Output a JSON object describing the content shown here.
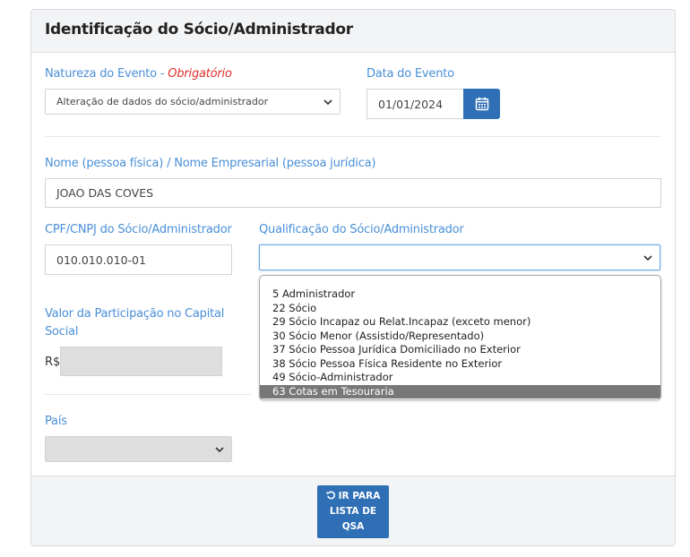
{
  "panel": {
    "title": "Identificação do Sócio/Administrador"
  },
  "natureza": {
    "label": "Natureza do Evento - ",
    "required": "Obrigatório",
    "value": "Alteração de dados do sócio/administrador"
  },
  "data_evento": {
    "label": "Data do Evento",
    "value": "01/01/2024",
    "icon": "calendar-icon"
  },
  "nome": {
    "label": "Nome (pessoa física) / Nome Empresarial (pessoa jurídica)",
    "value": "JOAO DAS COVES"
  },
  "cpf": {
    "label": "CPF/CNPJ do Sócio/Administrador",
    "value": "010.010.010-01"
  },
  "qualificacao": {
    "label": "Qualificação do Sócio/Administrador",
    "value": "",
    "options": [
      "5 Administrador",
      "22 Sócio",
      "29 Sócio Incapaz ou Relat.Incapaz (exceto menor)",
      "30 Sócio Menor (Assistido/Representado)",
      "37 Sócio Pessoa Jurídica Domiciliado no Exterior",
      "38 Sócio Pessoa Física Residente no Exterior",
      "49 Sócio-Administrador",
      "63 Cotas em Tesouraria"
    ],
    "highlighted_index": 7
  },
  "valor": {
    "label_line1": "Valor da Participação no Capital",
    "label_line2": "Social",
    "currency": "R$",
    "value": ""
  },
  "pais": {
    "label": "País",
    "value": ""
  },
  "footer": {
    "button_line1": "IR PARA",
    "button_line2": "LISTA DE QSA",
    "button_icon": "undo-icon"
  },
  "colors": {
    "label": "#4a8fd8",
    "required": "#e0302b",
    "primary": "#2f6fb5",
    "highlight": "#787878"
  }
}
